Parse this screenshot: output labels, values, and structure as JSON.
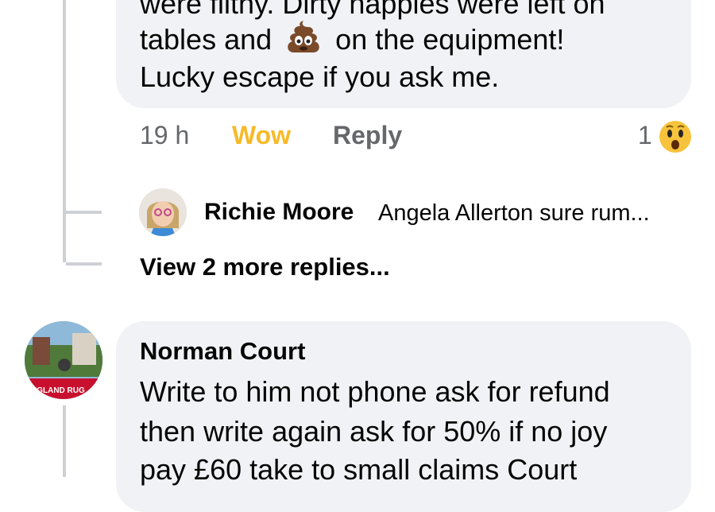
{
  "comment1": {
    "lines": [
      "were filthy. Dirty nappies were left on",
      "tables and",
      "on the equipment!",
      "Lucky escape if you ask me."
    ],
    "time": "19 h",
    "reaction_label": "Wow",
    "reply_label": "Reply",
    "reaction_count": "1"
  },
  "reply": {
    "name": "Richie Moore",
    "snippet": "Angela Allerton sure rum..."
  },
  "more_replies": "View 2 more replies...",
  "comment2": {
    "name": "Norman Court",
    "lines": [
      "Write to him not phone ask for refund",
      "then write again ask for 50% if no joy",
      "pay £60 take to small claims Court"
    ],
    "avatar_banner": "NGLAND RUG"
  },
  "colors": {
    "bubble": "#f0f2f5",
    "wow": "#f7b928",
    "meta": "#65676b",
    "thread": "#ced0d4"
  }
}
